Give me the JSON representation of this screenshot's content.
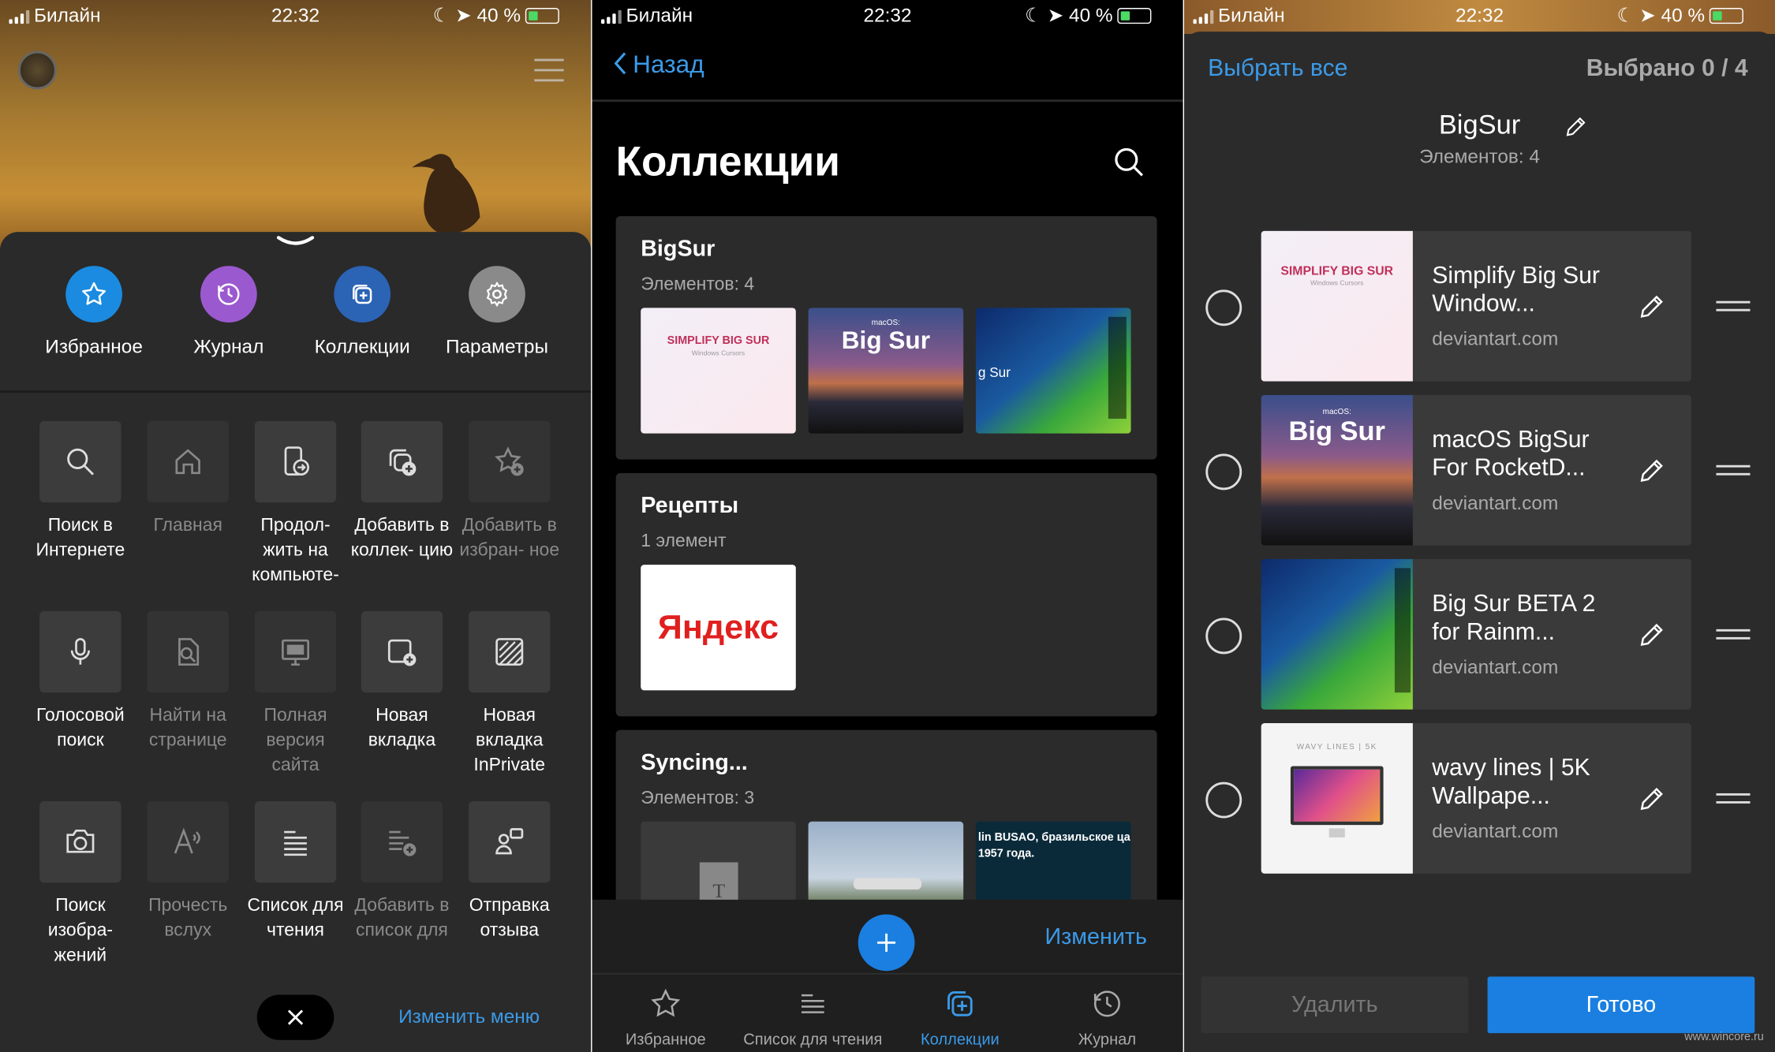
{
  "status": {
    "carrier": "Билайн",
    "time": "22:32",
    "battery": "40 %"
  },
  "panel1": {
    "top_icons": [
      {
        "label": "Избранное",
        "icon": "star-icon",
        "color": "#1a8be0"
      },
      {
        "label": "Журнал",
        "icon": "history-icon",
        "color": "#9b59d0"
      },
      {
        "label": "Коллекции",
        "icon": "collections-icon",
        "color": "#2b63b5"
      },
      {
        "label": "Параметры",
        "icon": "gear-icon",
        "color": "#8a8a8a"
      }
    ],
    "tiles": [
      {
        "label": "Поиск в Интернете",
        "icon": "search-icon",
        "dim": false
      },
      {
        "label": "Главная",
        "icon": "home-icon",
        "dim": true
      },
      {
        "label": "Продол- жить на компьюте-",
        "icon": "continue-pc-icon",
        "dim": false
      },
      {
        "label": "Добавить в коллек- цию",
        "icon": "add-collection-icon",
        "dim": false
      },
      {
        "label": "Добавить в избран- ное",
        "icon": "add-favorite-icon",
        "dim": true
      },
      {
        "label": "Голосовой поиск",
        "icon": "microphone-icon",
        "dim": false
      },
      {
        "label": "Найти на странице",
        "icon": "find-on-page-icon",
        "dim": true
      },
      {
        "label": "Полная версия сайта",
        "icon": "desktop-icon",
        "dim": true
      },
      {
        "label": "Новая вкладка",
        "icon": "new-tab-icon",
        "dim": false
      },
      {
        "label": "Новая вкладка InPrivate",
        "icon": "inprivate-icon",
        "dim": false
      },
      {
        "label": "Поиск изобра- жений",
        "icon": "camera-icon",
        "dim": false
      },
      {
        "label": "Прочесть вслух",
        "icon": "read-aloud-icon",
        "dim": true
      },
      {
        "label": "Список для чтения",
        "icon": "reading-list-icon",
        "dim": false
      },
      {
        "label": "Добавить в список для",
        "icon": "add-reading-list-icon",
        "dim": true
      },
      {
        "label": "Отправка отзыва",
        "icon": "feedback-icon",
        "dim": false
      }
    ],
    "edit_menu": "Изменить меню"
  },
  "panel2": {
    "back": "Назад",
    "title": "Коллекции",
    "cards": [
      {
        "title": "BigSur",
        "subtitle": "Элементов: 4"
      },
      {
        "title": "Рецепты",
        "subtitle": "1 элемент"
      },
      {
        "title": "Syncing...",
        "subtitle": "Элементов: 3"
      }
    ],
    "thumb_texts": {
      "simplify": "SIMPLIFY BIG SUR",
      "simplify_sub": "Windows Cursors",
      "macos_small": "macOS:",
      "bigsur": "Big Sur",
      "gsur": "g Sur",
      "yandex": "Яндекс",
      "busao": "lin BUSAO, бразильское ца 1957 года."
    },
    "edit": "Изменить",
    "tabs": [
      {
        "label": "Избранное",
        "icon": "star-icon",
        "active": false
      },
      {
        "label": "Список для чтения",
        "icon": "reading-list-icon",
        "active": false
      },
      {
        "label": "Коллекции",
        "icon": "collections-icon",
        "active": true
      },
      {
        "label": "Журнал",
        "icon": "history-icon",
        "active": false
      }
    ]
  },
  "panel3": {
    "select_all": "Выбрать все",
    "selected": "Выбрано 0 / 4",
    "collection_title": "BigSur",
    "collection_count": "Элементов: 4",
    "items": [
      {
        "title": "Simplify Big Sur Window...",
        "domain": "deviantart.com"
      },
      {
        "title": "macOS BigSur For RocketD...",
        "domain": "deviantart.com"
      },
      {
        "title": "Big Sur BETA 2 for Rainm...",
        "domain": "deviantart.com"
      },
      {
        "title": "wavy lines | 5K Wallpape...",
        "domain": "deviantart.com"
      }
    ],
    "thumb_wavy": "WAVY LINES | 5K",
    "delete": "Удалить",
    "done": "Готово"
  },
  "watermark": "www.wincore.ru"
}
